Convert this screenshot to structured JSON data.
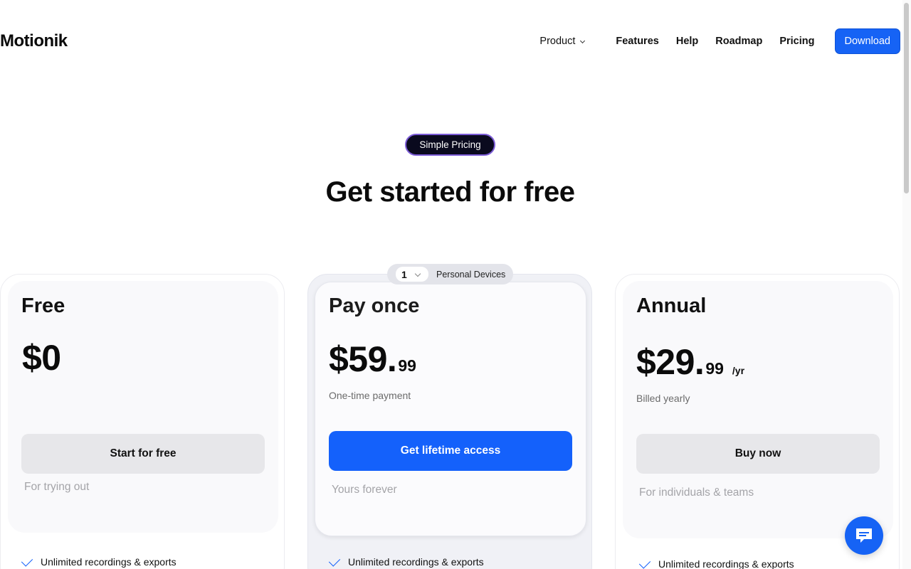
{
  "brand": {
    "logo": "Motionik"
  },
  "nav": {
    "product": "Product",
    "features": "Features",
    "help": "Help",
    "roadmap": "Roadmap",
    "pricing": "Pricing",
    "download": "Download"
  },
  "hero": {
    "badge": "Simple Pricing",
    "headline": "Get started for free"
  },
  "device_selector": {
    "count": "1",
    "label": "Personal Devices"
  },
  "plans": [
    {
      "name": "Free",
      "price_main": "$0",
      "cta": "Start for free",
      "tagline": "For trying out",
      "feature": "Unlimited recordings & exports"
    },
    {
      "name": "Pay once",
      "price_main": "$59.",
      "price_cents": "99",
      "subtitle": "One-time payment",
      "cta": "Get lifetime access",
      "tagline": "Yours forever",
      "feature": "Unlimited recordings & exports"
    },
    {
      "name": "Annual",
      "price_main": "$29.",
      "price_cents": "99",
      "price_period": "/yr",
      "subtitle": "Billed yearly",
      "cta": "Buy now",
      "tagline": "For individuals & teams",
      "feature": "Unlimited recordings & exports"
    }
  ],
  "colors": {
    "accent": "#1663f5",
    "badge_bg": "#0a0a1e",
    "badge_border": "#7c5cd6"
  },
  "icons": {
    "chat": "chat-bubble-icon",
    "check": "check-icon",
    "chevron": "chevron-down-icon"
  }
}
